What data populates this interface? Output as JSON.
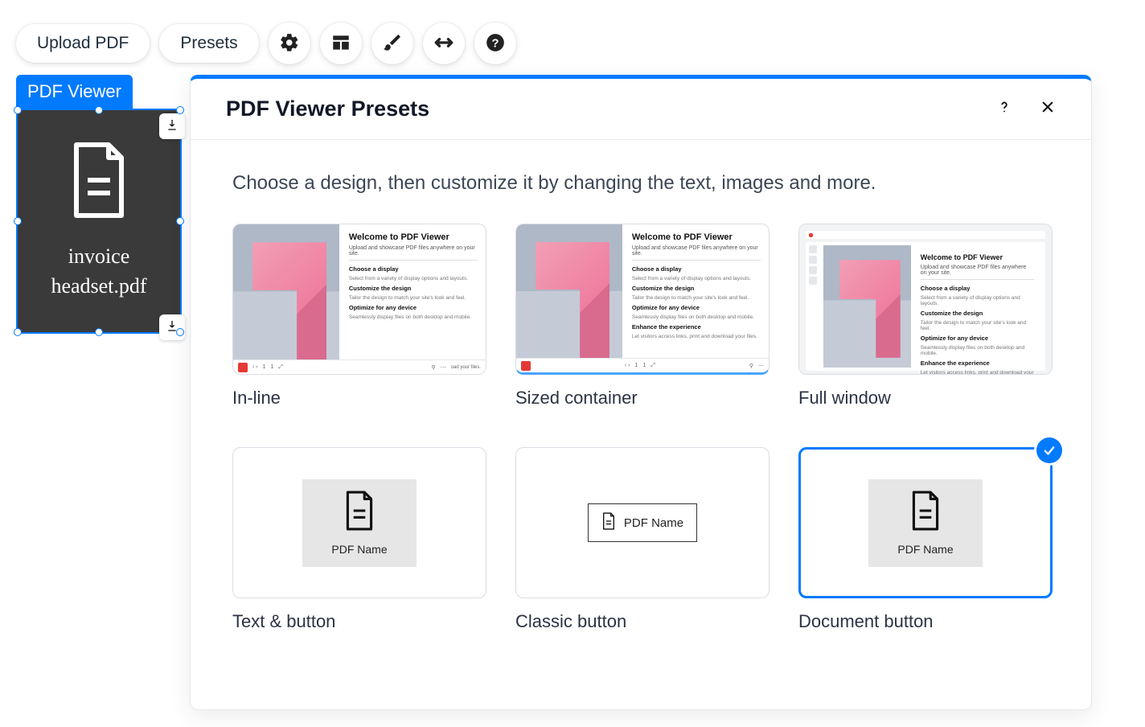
{
  "toolbar": {
    "upload_label": "Upload PDF",
    "presets_label": "Presets"
  },
  "widget": {
    "tab_label": "PDF Viewer",
    "filename_line1": "invoice",
    "filename_line2": "headset.pdf"
  },
  "panel": {
    "title": "PDF Viewer Presets",
    "subtitle": "Choose a design, then customize it by changing the text, images and more."
  },
  "presets": [
    {
      "name": "In-line"
    },
    {
      "name": "Sized container"
    },
    {
      "name": "Full window"
    },
    {
      "name": "Text & button"
    },
    {
      "name": "Classic button"
    },
    {
      "name": "Document button"
    }
  ],
  "preview_text": {
    "heading": "Welcome to PDF Viewer",
    "sub": "Upload and showcase PDF files anywhere on your site.",
    "s1t": "Choose a display",
    "s1d": "Select from a variety of display options and layouts.",
    "s2t": "Customize the design",
    "s2d": "Tailor the design to match your site's look and feel.",
    "s3t": "Optimize for any device",
    "s3d": "Seamlessly display files on both desktop and mobile.",
    "s4t": "Enhance the experience",
    "s4d": "Let visitors access links, print and download your files."
  },
  "preview_name_label": "PDF Name",
  "selected_preset_index": 5
}
